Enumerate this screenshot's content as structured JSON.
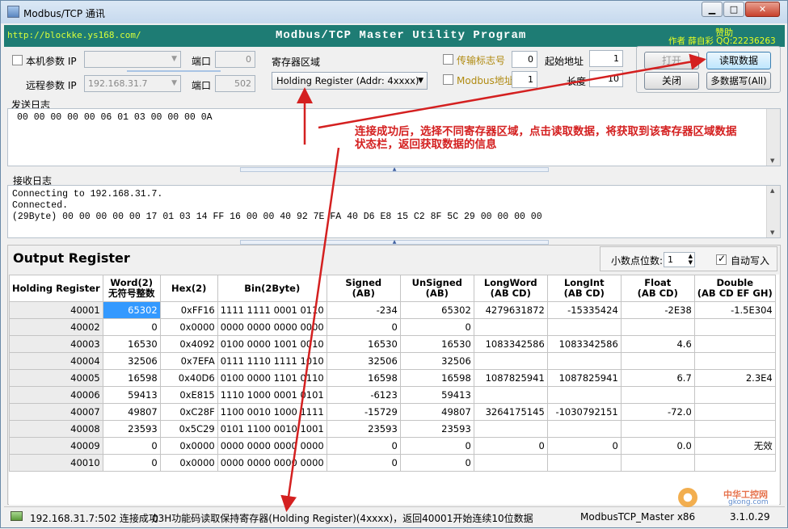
{
  "window": {
    "title": "Modbus/TCP 通讯",
    "minimize": "▁",
    "maximize": "□",
    "close": "✕"
  },
  "banner": {
    "url": "http://blockke.ys168.com/",
    "title": "Modbus/TCP Master Utility Program",
    "donate": "赞助",
    "author": "作者 薛自彩 QQ:22236263"
  },
  "conn": {
    "local_label": "本机参数 IP",
    "local_ip": "",
    "local_port_label": "端口",
    "local_port": "0",
    "remote_label": "远程参数 IP",
    "remote_ip": "192.168.31.7",
    "remote_port_label": "端口",
    "remote_port": "502",
    "reg_area_label": "寄存器区域",
    "reg_area_value": "Holding Register (Addr: 4xxxx)",
    "trans_flag_label": "传输标志号",
    "trans_flag": "0",
    "modbus_addr_label": "Modbus地址",
    "modbus_addr": "1",
    "start_addr_label": "起始地址",
    "start_addr": "1",
    "length_label": "长度",
    "length": "10"
  },
  "buttons": {
    "open": "打开",
    "close": "关闭",
    "read": "读取数据",
    "multi_write": "多数据写(All)"
  },
  "send_log": {
    "title": "发送日志",
    "text": "00 00 00 00 00 06 01 03 00 00 00 0A"
  },
  "recv_log": {
    "title": "接收日志",
    "lines": [
      "Connecting to 192.168.31.7.",
      "Connected.",
      "(29Byte) 00 00 00 00 00 17 01 03 14 FF 16 00 00 40 92 7E FA 40 D6 E8 15 C2 8F 5C 29 00 00 00 00"
    ]
  },
  "annotation": {
    "line1": "连接成功后，选择不同寄存器区域，点击读取数据，将获取到该寄存器区域数据",
    "line2": "状态栏，返回获取数据的信息"
  },
  "output": {
    "title": "Output Register",
    "decimal_label": "小数点位数:",
    "decimal_value": "1",
    "auto_write_label": "自动写入",
    "columns": [
      [
        "Holding Register",
        ""
      ],
      [
        "Word(2)",
        "无符号整数"
      ],
      [
        "Hex(2)",
        ""
      ],
      [
        "Bin(2Byte)",
        ""
      ],
      [
        "Signed",
        "(AB)"
      ],
      [
        "UnSigned",
        "(AB)"
      ],
      [
        "LongWord",
        "(AB CD)"
      ],
      [
        "LongInt",
        "(AB CD)"
      ],
      [
        "Float",
        "(AB CD)"
      ],
      [
        "Double",
        "(AB CD EF GH)"
      ]
    ],
    "rows": [
      [
        "40001",
        "65302",
        "0xFF16",
        "1111 1111 0001 0110",
        "-234",
        "65302",
        "4279631872",
        "-15335424",
        "-2E38",
        "-1.5E304"
      ],
      [
        "40002",
        "0",
        "0x0000",
        "0000 0000 0000 0000",
        "0",
        "0",
        "",
        "",
        "",
        ""
      ],
      [
        "40003",
        "16530",
        "0x4092",
        "0100 0000 1001 0010",
        "16530",
        "16530",
        "1083342586",
        "1083342586",
        "4.6",
        ""
      ],
      [
        "40004",
        "32506",
        "0x7EFA",
        "0111 1110 1111 1010",
        "32506",
        "32506",
        "",
        "",
        "",
        ""
      ],
      [
        "40005",
        "16598",
        "0x40D6",
        "0100 0000 1101 0110",
        "16598",
        "16598",
        "1087825941",
        "1087825941",
        "6.7",
        "2.3E4"
      ],
      [
        "40006",
        "59413",
        "0xE815",
        "1110 1000 0001 0101",
        "-6123",
        "59413",
        "",
        "",
        "",
        ""
      ],
      [
        "40007",
        "49807",
        "0xC28F",
        "1100 0010 1000 1111",
        "-15729",
        "49807",
        "3264175145",
        "-1030792151",
        "-72.0",
        ""
      ],
      [
        "40008",
        "23593",
        "0x5C29",
        "0101 1100 0010 1001",
        "23593",
        "23593",
        "",
        "",
        "",
        ""
      ],
      [
        "40009",
        "0",
        "0x0000",
        "0000 0000 0000 0000",
        "0",
        "0",
        "0",
        "0",
        "0.0",
        "无效"
      ],
      [
        "40010",
        "0",
        "0x0000",
        "0000 0000 0000 0000",
        "0",
        "0",
        "",
        "",
        "",
        ""
      ]
    ]
  },
  "status": {
    "connection": "192.168.31.7:502 连接成功",
    "message": "03H功能码读取保持寄存器(Holding Register)(4xxxx)，返回40001开始连续10位数据",
    "app": "ModbusTCP_Master x86",
    "version": "3.1.0.29"
  },
  "watermark": {
    "text": "中华工控网",
    "sub": "gkong.com"
  },
  "colors": {
    "banner": "#1e7c74",
    "annotation": "#d42020",
    "selected_cell": "#3399ff"
  }
}
